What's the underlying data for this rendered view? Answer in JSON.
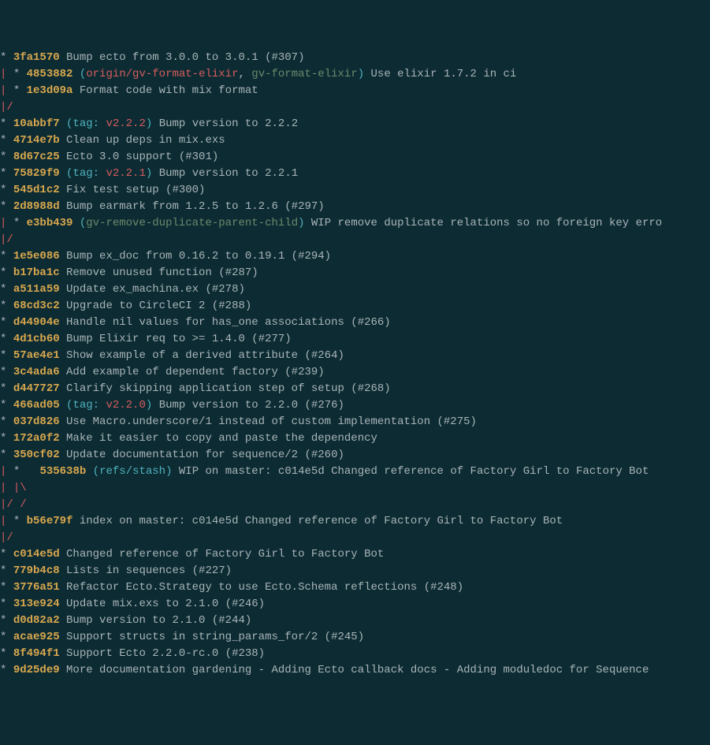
{
  "lines": [
    {
      "graph": "* ",
      "hash": "3fa1570",
      "after": " ",
      "msg": "Bump ecto from 3.0.0 to 3.0.1 (#307)"
    },
    {
      "graph": "| * ",
      "hash": "4853882",
      "after": " ",
      "refs": [
        {
          "open": "(",
          "parts": [
            {
              "t": "branch-remote",
              "v": "origin/gv-format-elixir"
            },
            {
              "t": "msg",
              "v": ", "
            },
            {
              "t": "branch-local",
              "v": "gv-format-elixir"
            }
          ],
          "close": ") "
        }
      ],
      "msg": "Use elixir 1.7.2 in ci"
    },
    {
      "graph": "| * ",
      "hash": "1e3d09a",
      "after": " ",
      "msg": "Format code with mix format"
    },
    {
      "graph": "|/"
    },
    {
      "graph": "* ",
      "hash": "10abbf7",
      "after": " ",
      "refs": [
        {
          "open": "(",
          "parts": [
            {
              "t": "tag-label",
              "v": "tag: "
            },
            {
              "t": "tag-val",
              "v": "v2.2.2"
            }
          ],
          "close": ") "
        }
      ],
      "msg": "Bump version to 2.2.2"
    },
    {
      "graph": "* ",
      "hash": "4714e7b",
      "after": " ",
      "msg": "Clean up deps in mix.exs"
    },
    {
      "graph": "* ",
      "hash": "8d67c25",
      "after": " ",
      "msg": "Ecto 3.0 support (#301)"
    },
    {
      "graph": "* ",
      "hash": "75829f9",
      "after": " ",
      "refs": [
        {
          "open": "(",
          "parts": [
            {
              "t": "tag-label",
              "v": "tag: "
            },
            {
              "t": "tag-val",
              "v": "v2.2.1"
            }
          ],
          "close": ") "
        }
      ],
      "msg": "Bump version to 2.2.1"
    },
    {
      "graph": "* ",
      "hash": "545d1c2",
      "after": " ",
      "msg": "Fix test setup (#300)"
    },
    {
      "graph": "* ",
      "hash": "2d8988d",
      "after": " ",
      "msg": "Bump earmark from 1.2.5 to 1.2.6 (#297)"
    },
    {
      "graph": "| * ",
      "hash": "e3bb439",
      "after": " ",
      "refs": [
        {
          "open": "(",
          "parts": [
            {
              "t": "branch-local",
              "v": "gv-remove-duplicate-parent-child"
            }
          ],
          "close": ") "
        }
      ],
      "msg": "WIP remove duplicate relations so no foreign key erro"
    },
    {
      "graph": "|/"
    },
    {
      "graph": "* ",
      "hash": "1e5e086",
      "after": " ",
      "msg": "Bump ex_doc from 0.16.2 to 0.19.1 (#294)"
    },
    {
      "graph": "* ",
      "hash": "b17ba1c",
      "after": " ",
      "msg": "Remove unused function (#287)"
    },
    {
      "graph": "* ",
      "hash": "a511a59",
      "after": " ",
      "msg": "Update ex_machina.ex (#278)"
    },
    {
      "graph": "* ",
      "hash": "68cd3c2",
      "after": " ",
      "msg": "Upgrade to CircleCI 2 (#288)"
    },
    {
      "graph": "* ",
      "hash": "d44904e",
      "after": " ",
      "msg": "Handle nil values for has_one associations (#266)"
    },
    {
      "graph": "* ",
      "hash": "4d1cb60",
      "after": " ",
      "msg": "Bump Elixir req to >= 1.4.0 (#277)"
    },
    {
      "graph": "* ",
      "hash": "57ae4e1",
      "after": " ",
      "msg": "Show example of a derived attribute (#264)"
    },
    {
      "graph": "* ",
      "hash": "3c4ada6",
      "after": " ",
      "msg": "Add example of dependent factory (#239)"
    },
    {
      "graph": "* ",
      "hash": "d447727",
      "after": " ",
      "msg": "Clarify skipping application step of setup (#268)"
    },
    {
      "graph": "* ",
      "hash": "466ad05",
      "after": " ",
      "refs": [
        {
          "open": "(",
          "parts": [
            {
              "t": "tag-label",
              "v": "tag: "
            },
            {
              "t": "tag-val",
              "v": "v2.2.0"
            }
          ],
          "close": ") "
        }
      ],
      "msg": "Bump version to 2.2.0 (#276)"
    },
    {
      "graph": "* ",
      "hash": "037d826",
      "after": " ",
      "msg": "Use Macro.underscore/1 instead of custom implementation (#275)"
    },
    {
      "graph": "* ",
      "hash": "172a0f2",
      "after": " ",
      "msg": "Make it easier to copy and paste the dependency"
    },
    {
      "graph": "* ",
      "hash": "350cf02",
      "after": " ",
      "msg": "Update documentation for sequence/2 (#260)"
    },
    {
      "graph": "| *   ",
      "hash": "535638b",
      "after": " ",
      "refs": [
        {
          "open": "(",
          "parts": [
            {
              "t": "ref",
              "v": "refs/stash"
            }
          ],
          "close": ") "
        }
      ],
      "msg": "WIP on master: c014e5d Changed reference of Factory Girl to Factory Bot"
    },
    {
      "graph": "| |\\"
    },
    {
      "graph": "|/ /"
    },
    {
      "graph": "| * ",
      "hash": "b56e79f",
      "after": " ",
      "msg": "index on master: c014e5d Changed reference of Factory Girl to Factory Bot"
    },
    {
      "graph": "|/"
    },
    {
      "graph": "* ",
      "hash": "c014e5d",
      "after": " ",
      "msg": "Changed reference of Factory Girl to Factory Bot"
    },
    {
      "graph": "* ",
      "hash": "779b4c8",
      "after": " ",
      "msg": "Lists in sequences (#227)"
    },
    {
      "graph": "* ",
      "hash": "3776a51",
      "after": " ",
      "msg": "Refactor Ecto.Strategy to use Ecto.Schema reflections (#248)"
    },
    {
      "graph": "* ",
      "hash": "313e924",
      "after": " ",
      "msg": "Update mix.exs to 2.1.0 (#246)"
    },
    {
      "graph": "* ",
      "hash": "d0d82a2",
      "after": " ",
      "msg": "Bump version to 2.1.0 (#244)"
    },
    {
      "graph": "* ",
      "hash": "acae925",
      "after": " ",
      "msg": "Support structs in string_params_for/2 (#245)"
    },
    {
      "graph": "* ",
      "hash": "8f494f1",
      "after": " ",
      "msg": "Support Ecto 2.2.0-rc.0 (#238)"
    },
    {
      "graph": "* ",
      "hash": "9d25de9",
      "after": " ",
      "msg": "More documentation gardening - Adding Ecto callback docs - Adding moduledoc for Sequence"
    }
  ]
}
